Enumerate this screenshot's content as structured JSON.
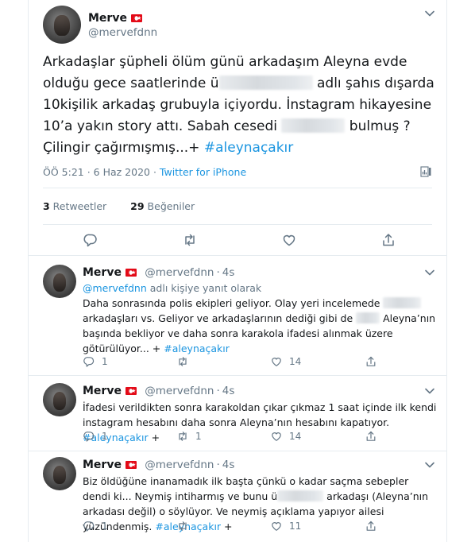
{
  "main_tweet": {
    "name": "Merve",
    "handle": "@mervefdnn",
    "text_parts": [
      "Arkadaşlar şüpheli ölüm günü arkadaşım Aleyna evde olduğu gece saatlerinde ü",
      " adlı şahıs dışarda 10kişilik arkadaş grubuyla içiyordu. İnstagram hikayesine 10’a yakın story attı. Sabah cesedi ",
      " bulmuş ? Çilingir çağırmışmış...+ "
    ],
    "hashtag": "#aleynaçakır",
    "time": "ÖÖ 5:21 · 6 Haz 2020 · ",
    "source": "Twitter for iPhone",
    "retweets_count": "3",
    "retweets_label": " Retweetler",
    "likes_count": "29",
    "likes_label": " Beğeniler"
  },
  "replies": [
    {
      "name": "Merve",
      "handle": "@mervefdnn",
      "dot": "·",
      "time": "4s",
      "replying_handle": "@mervefdnn",
      "replying_text": " adlı kişiye yanıt olarak",
      "text_parts": [
        "Daha sonrasında polis ekipleri geliyor. Olay yeri incelemede ",
        " arkadaşları vs. Geliyor ve arkadaşlarının dediği gibi de ",
        " Aleyna’nın başında bekliyor ve daha sonra karakola ifadesi alınmak üzere götürülüyor... + "
      ],
      "hashtag": "#aleynaçakır",
      "reply_count": "1",
      "retweet_count": "",
      "like_count": "14"
    },
    {
      "name": "Merve",
      "handle": "@mervefdnn",
      "dot": "·",
      "time": "4s",
      "text_parts": [
        "İfadesi verildikten sonra karakoldan çıkar çıkmaz 1 saat içinde ilk kendi instagram hesabını daha sonra Aleyna’nın hesabını kapatıyor. "
      ],
      "hashtag": "#aleynaçakır",
      "suffix": " +",
      "reply_count": "1",
      "retweet_count": "1",
      "like_count": "14"
    },
    {
      "name": "Merve",
      "handle": "@mervefdnn",
      "dot": "·",
      "time": "4s",
      "text_parts": [
        "Biz öldüğüne inanamadık ilk başta çünkü o kadar saçma sebepler dendi ki... Neymiş intiharmış ve bunu ü",
        " arkadaşı (Aleyna’nın arkadası değil) o söylüyor.  Ve neymiş açıklama yapıyor ailesi yüzündenmiş. "
      ],
      "hashtag": "#aleynaçakır",
      "suffix": " +",
      "reply_count": "1",
      "retweet_count": "",
      "like_count": "11"
    }
  ],
  "colors": {
    "accent": "#1b95e0",
    "secondary_text": "#657786",
    "border": "#e6ecf0"
  },
  "icons": [
    "chevron-down-icon",
    "turkey-flag-icon",
    "analytics-icon",
    "reply-icon",
    "retweet-icon",
    "like-icon",
    "share-icon"
  ]
}
